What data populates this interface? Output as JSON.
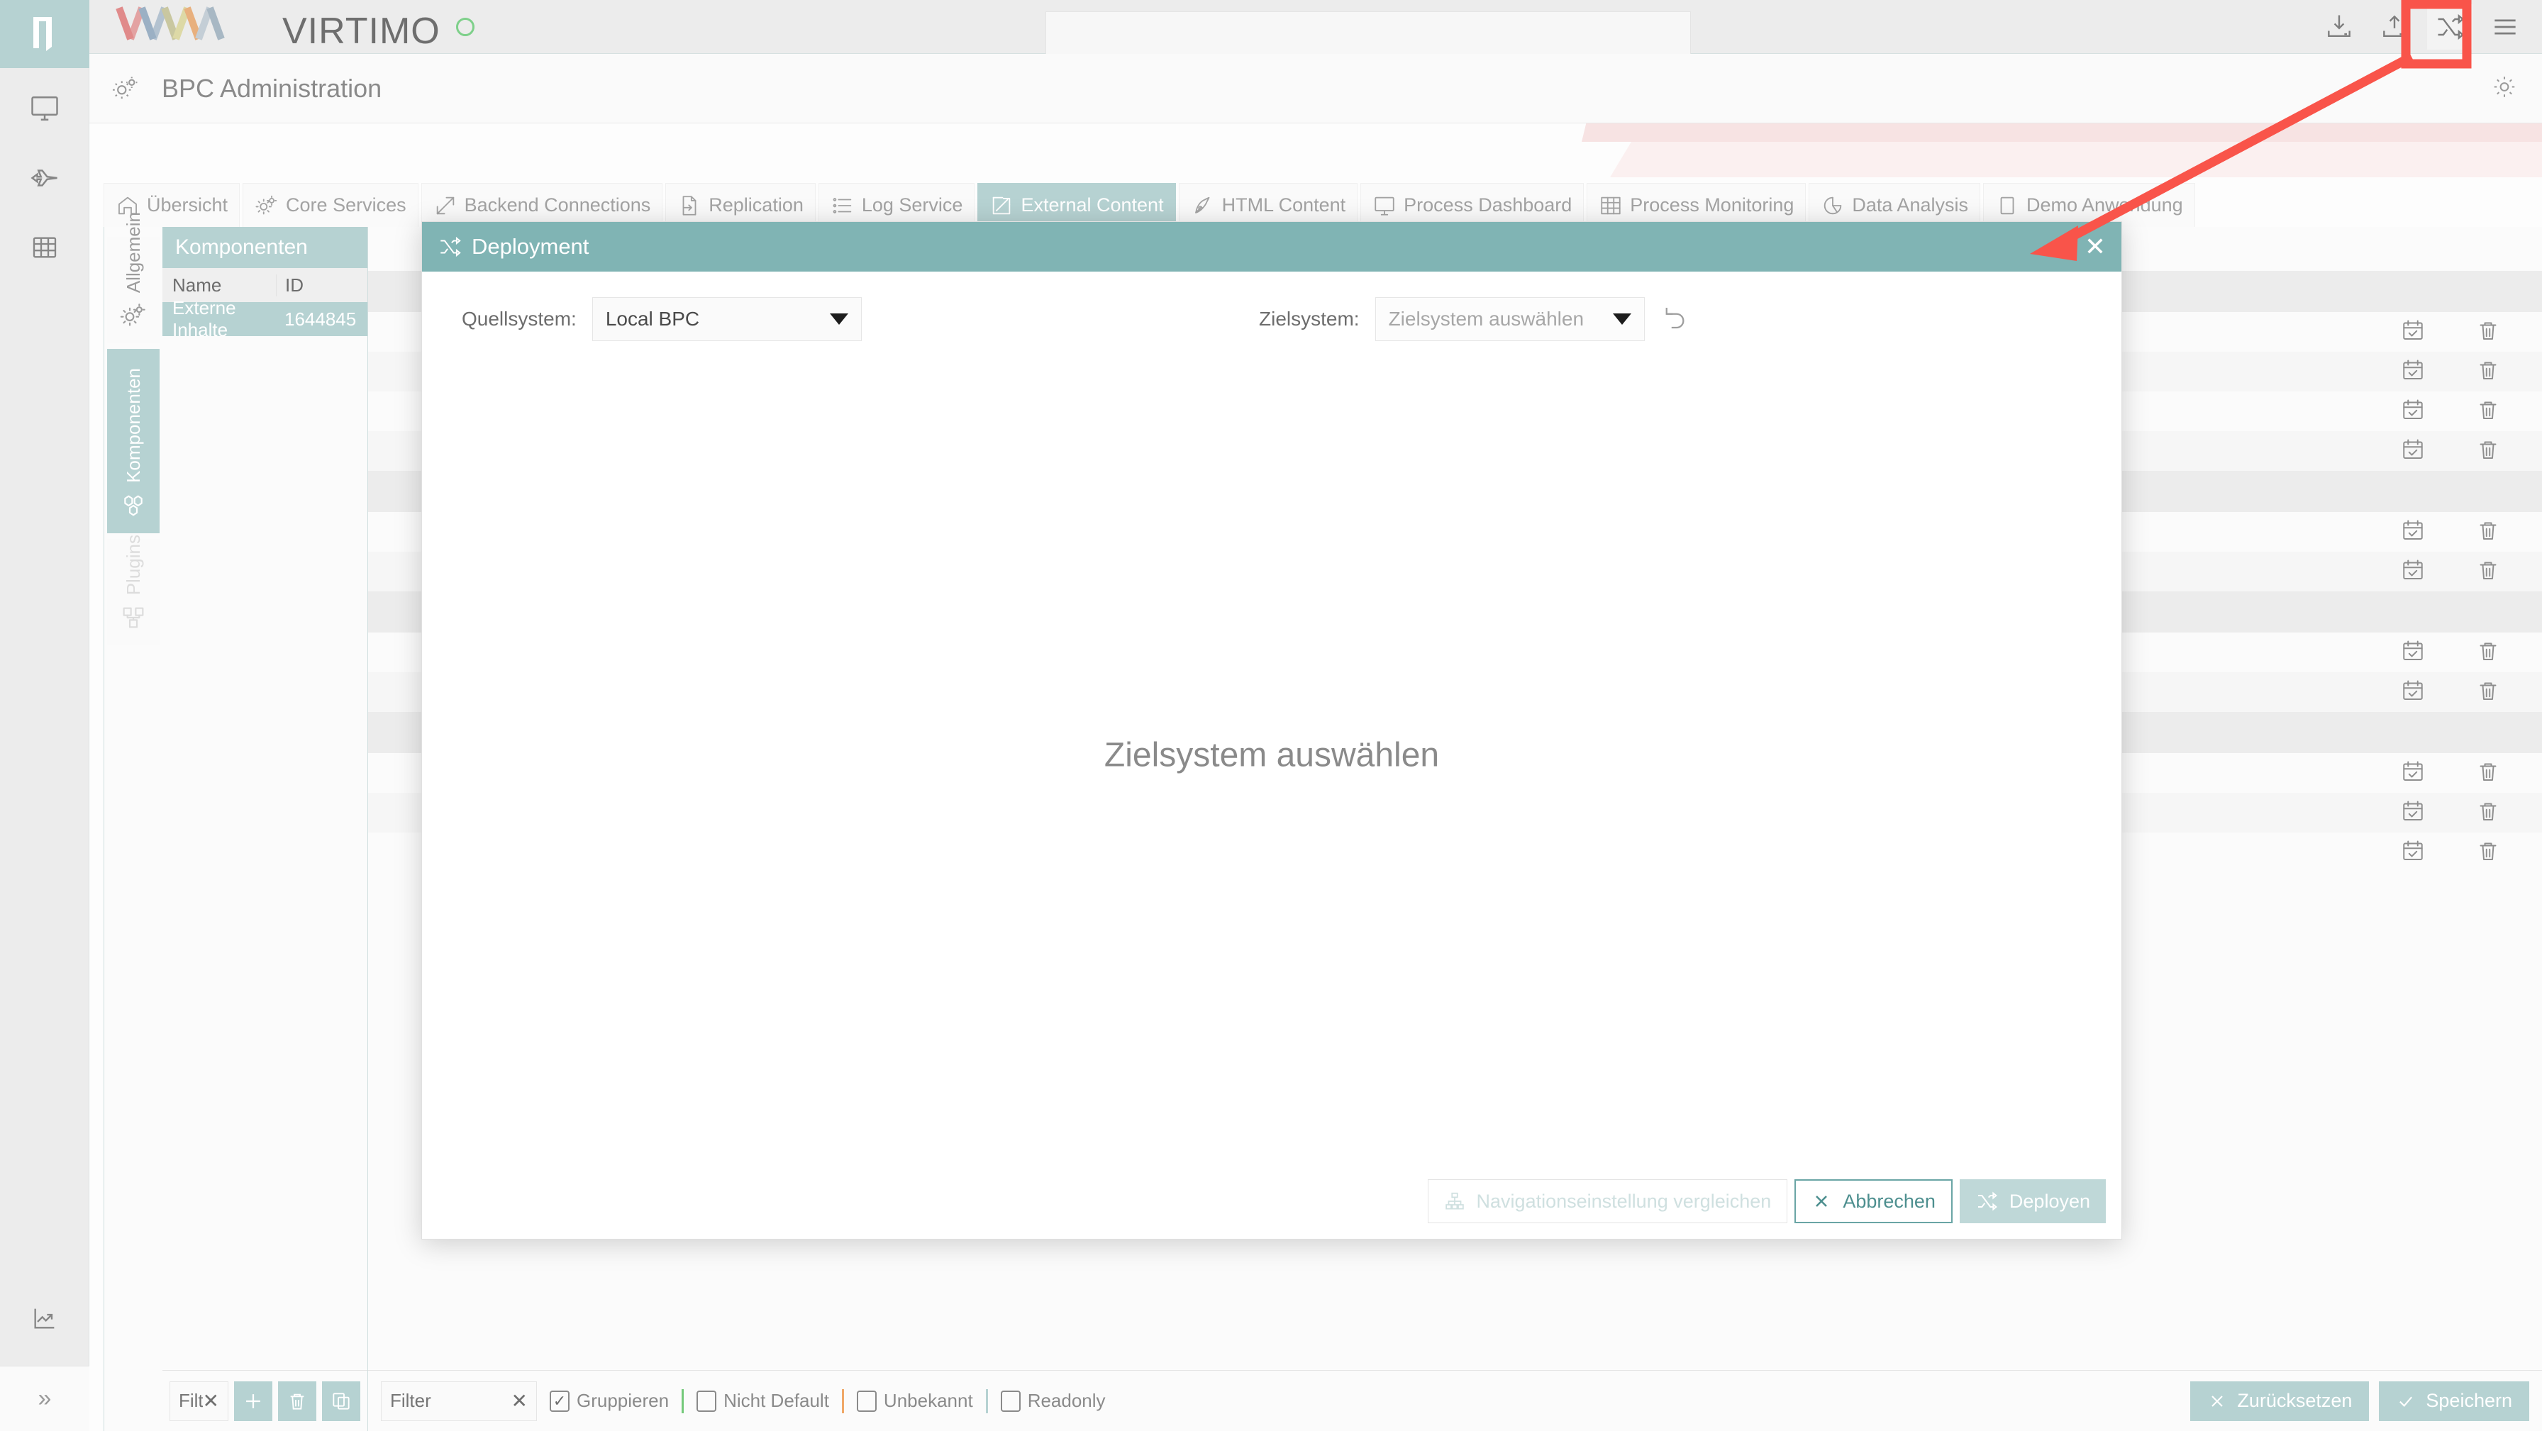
{
  "app": {
    "brand": "VIRTIMO",
    "page_title": "BPC Administration",
    "search_placeholder": ""
  },
  "rail": {
    "logo_label": "virtimo-logo",
    "items": [
      {
        "icon": "monitor-icon",
        "label": "Monitor"
      },
      {
        "icon": "jet-icon",
        "label": "Jet"
      },
      {
        "icon": "table-icon",
        "label": "Table"
      }
    ],
    "bottom_items": [
      {
        "icon": "analytics-icon",
        "label": "Analytics"
      }
    ],
    "collapse_label": "»"
  },
  "header": {
    "icons": [
      {
        "name": "import-icon",
        "label": "Import"
      },
      {
        "name": "export-icon",
        "label": "Export"
      },
      {
        "name": "deploy-shuffle-icon",
        "label": "Deployment",
        "highlighted": true
      },
      {
        "name": "hamburger-menu-icon",
        "label": "Menü"
      }
    ]
  },
  "tabs": [
    {
      "label": "Übersicht",
      "icon": "home-icon",
      "active": false
    },
    {
      "label": "Core Services",
      "icon": "gears-icon",
      "active": false
    },
    {
      "label": "Backend Connections",
      "icon": "arrow-diagonal-icon",
      "active": false
    },
    {
      "label": "Replication",
      "icon": "file-arrow-icon",
      "active": false
    },
    {
      "label": "Log Service",
      "icon": "list-icon",
      "active": false
    },
    {
      "label": "External Content",
      "icon": "external-link-icon",
      "active": true
    },
    {
      "label": "HTML Content",
      "icon": "pen-icon",
      "active": false
    },
    {
      "label": "Process Dashboard",
      "icon": "screen-icon",
      "active": false
    },
    {
      "label": "Process Monitoring",
      "icon": "grid-icon",
      "active": false
    },
    {
      "label": "Data Analysis",
      "icon": "pie-chart-icon",
      "active": false
    },
    {
      "label": "Demo Anwendung",
      "icon": "square-icon",
      "active": false
    }
  ],
  "side_tabs": [
    {
      "label": "Allgemein",
      "icon": "gears-icon",
      "active": false,
      "dim": false
    },
    {
      "label": "Komponenten",
      "icon": "cubes-icon",
      "active": true,
      "dim": false
    },
    {
      "label": "Plugins",
      "icon": "plugin-icon",
      "active": false,
      "dim": true
    }
  ],
  "components_panel": {
    "title": "Komponenten",
    "columns": [
      "Name",
      "ID"
    ],
    "rows": [
      {
        "name": "Externe Inhalte",
        "id": "1644845",
        "selected": true
      }
    ],
    "filter": {
      "value": "",
      "placeholder": "Filter",
      "clear_label": "✕"
    },
    "buttons": [
      {
        "name": "add-button",
        "label": "+"
      },
      {
        "name": "delete-button",
        "label": "delete"
      },
      {
        "name": "copy-button",
        "label": "copy"
      }
    ]
  },
  "detail_panel": {
    "filter": {
      "value": "",
      "placeholder": "Filter",
      "clear_label": "✕"
    },
    "checkboxes": [
      {
        "label": "Gruppieren",
        "checked": true,
        "marker": ""
      },
      {
        "label": "Nicht Default",
        "checked": false,
        "marker": "#74c97a"
      },
      {
        "label": "Unbekannt",
        "checked": false,
        "marker": "#f0a868"
      },
      {
        "label": "Readonly",
        "checked": false,
        "marker": "#b6d2d2"
      }
    ],
    "actions": [
      {
        "name": "reset-button",
        "label": "Zurücksetzen",
        "icon": "x-icon"
      },
      {
        "name": "save-button",
        "label": "Speichern",
        "icon": "check-icon"
      }
    ],
    "row_groups": [
      {
        "rows": 4
      },
      {
        "rows": 2
      },
      {
        "rows": 2
      },
      {
        "rows": 3
      }
    ],
    "row_icons": [
      "calendar-check-icon",
      "trash-icon"
    ]
  },
  "modal": {
    "title": "Deployment",
    "title_icon": "deploy-shuffle-icon",
    "close_label": "✕",
    "source": {
      "label": "Quellsystem:",
      "value": "Local BPC"
    },
    "target": {
      "label": "Zielsystem:",
      "placeholder": "Zielsystem auswählen",
      "value": "",
      "reset_icon": "undo-icon"
    },
    "center_message": "Zielsystem auswählen",
    "footer_buttons": [
      {
        "name": "compare-navigation-button",
        "label": "Navigationseinstellung vergleichen",
        "icon": "hierarchy-icon",
        "style": "ghost"
      },
      {
        "name": "cancel-button",
        "label": "Abbrechen",
        "icon": "x-icon",
        "style": "outline"
      },
      {
        "name": "deploy-button",
        "label": "Deployen",
        "icon": "deploy-shuffle-icon",
        "style": "filled"
      }
    ]
  },
  "annotation": {
    "type": "red-arrow-highlight",
    "target": "deploy-shuffle-icon",
    "color": "#f9544a"
  },
  "colors": {
    "accent": "#b6d2d2",
    "accent_dark": "#80b4b4",
    "annotation": "#f9544a",
    "text": "#6d6d6d"
  }
}
